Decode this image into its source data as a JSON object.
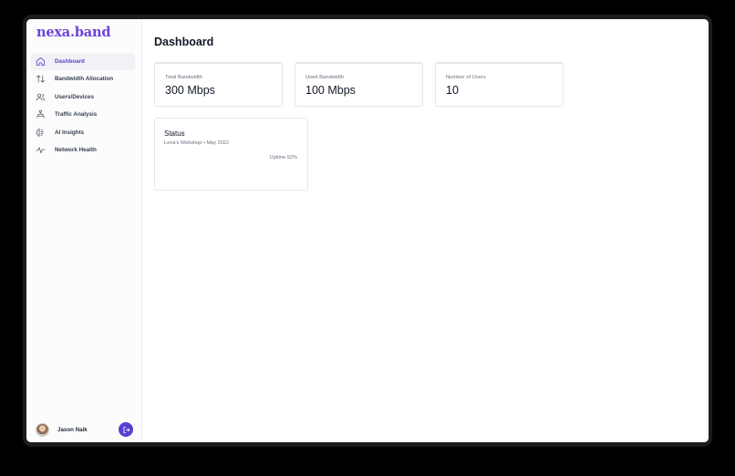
{
  "app": {
    "logo": "nexa.band",
    "accent_color": "#5b3fd1"
  },
  "sidebar": {
    "items": [
      {
        "label": "Dashboard",
        "icon": "home-icon",
        "active": true
      },
      {
        "label": "Bandwidth Allocation",
        "icon": "arrows-up-down-icon",
        "active": false
      },
      {
        "label": "Users/Devices",
        "icon": "users-icon",
        "active": false
      },
      {
        "label": "Traffic Analysis",
        "icon": "traffic-icon",
        "active": false
      },
      {
        "label": "AI Insights",
        "icon": "ai-brain-icon",
        "active": false
      },
      {
        "label": "Network Health",
        "icon": "pulse-icon",
        "active": false
      }
    ],
    "user": {
      "name": "Jason Naik",
      "avatar": "user-avatar",
      "logout_icon": "logout-icon"
    }
  },
  "main": {
    "title": "Dashboard",
    "stats": [
      {
        "label": "Total Bandwidth",
        "value": "300 Mbps"
      },
      {
        "label": "Used Bandwidth",
        "value": "100 Mbps"
      },
      {
        "label": "Number of Users",
        "value": "10"
      }
    ],
    "status": {
      "title": "Status",
      "subtitle": "Lena's Webshop • May 2022",
      "uptime": "Uptime 92%"
    }
  }
}
